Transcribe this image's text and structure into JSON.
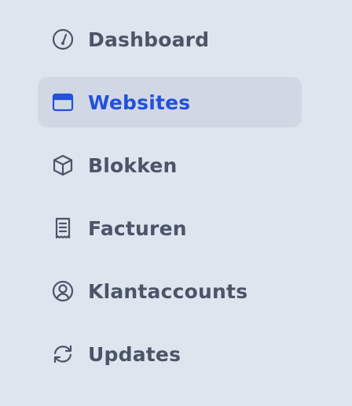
{
  "sidebar": {
    "items": [
      {
        "label": "Dashboard",
        "icon": "gauge-icon",
        "active": false
      },
      {
        "label": "Websites",
        "icon": "browser-window-icon",
        "active": true
      },
      {
        "label": "Blokken",
        "icon": "cube-icon",
        "active": false
      },
      {
        "label": "Facturen",
        "icon": "receipt-icon",
        "active": false
      },
      {
        "label": "Klantaccounts",
        "icon": "user-circle-icon",
        "active": false
      },
      {
        "label": "Updates",
        "icon": "refresh-icon",
        "active": false
      }
    ]
  },
  "colors": {
    "background": "#dfe5ee",
    "active_background": "#d1d8e4",
    "text": "#4b5567",
    "accent": "#2350dc"
  }
}
